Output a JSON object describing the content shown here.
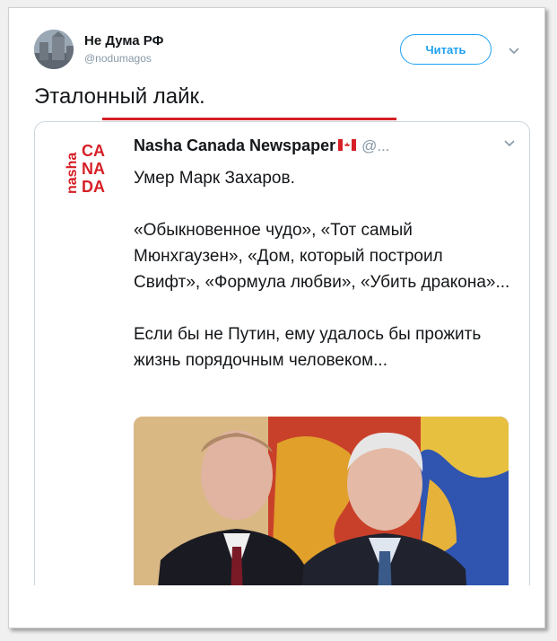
{
  "tweet": {
    "user_name": "Не Дума РФ",
    "handle": "@nodumagos",
    "follow_label": "Читать",
    "text": "Эталонный лайк."
  },
  "quoted": {
    "name": "Nasha Canada Newspaper",
    "handle": "@...",
    "line1": "Умер Марк Захаров.",
    "para2": "«Обыкновенное чудо», «Тот самый Мюнхгаузен», «Дом, который построил Свифт», «Формула любви», «Убить дракона»...",
    "para3": "Если бы не Путин, ему удалось бы прожить жизнь порядочным человеком...",
    "logo": {
      "nasha": "nasha",
      "letters_ca": "CA",
      "letters_na": "NA",
      "letters_da": "DA"
    }
  },
  "colors": {
    "accent": "#1da1f2",
    "logo_red": "#d61f26",
    "red_line": "#d61f26"
  },
  "icons": {
    "chevron": "chevron-down-icon",
    "flag": "canada-flag-icon"
  }
}
